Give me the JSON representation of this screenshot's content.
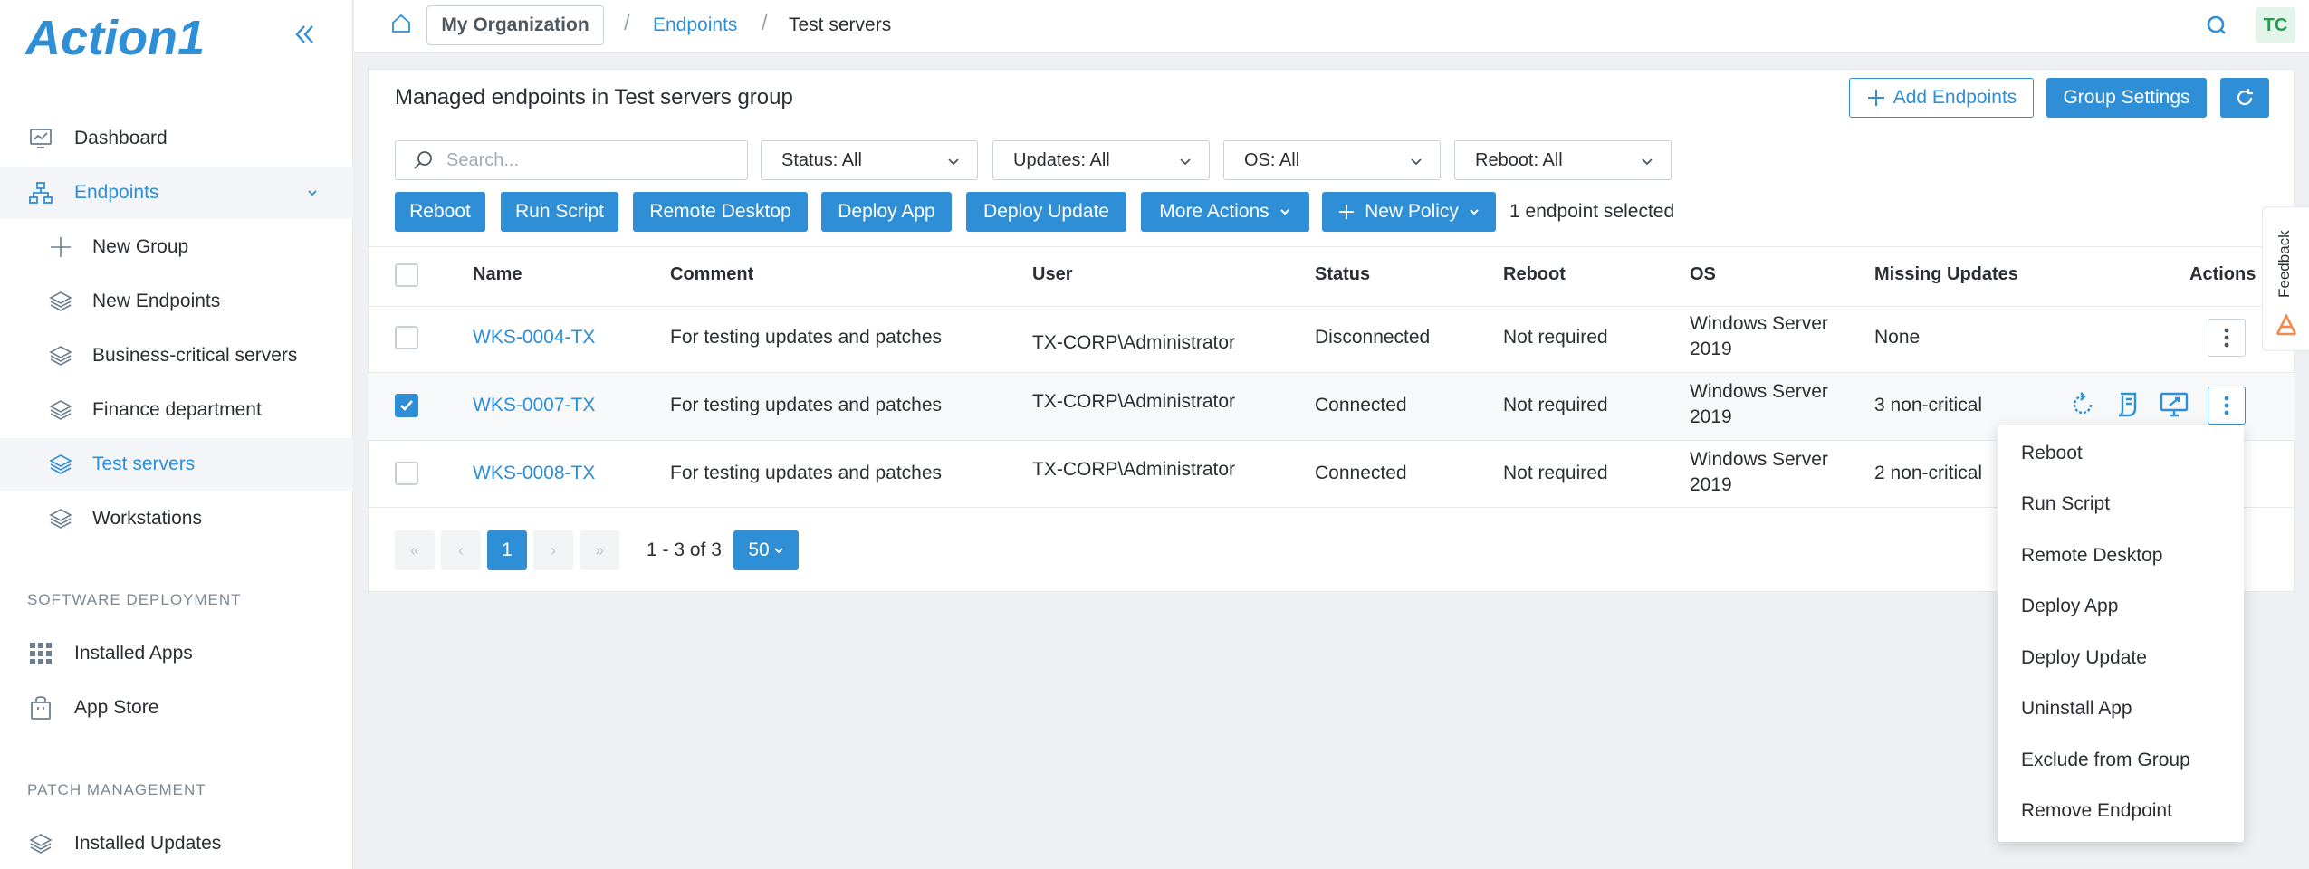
{
  "brand": {
    "logo_text": "Action1",
    "accent": "#2f8fd6"
  },
  "sidebar": {
    "items": [
      {
        "label": "Dashboard",
        "icon": "dashboard-icon"
      },
      {
        "label": "Endpoints",
        "icon": "network-icon",
        "expanded": true
      },
      {
        "label": "New Group",
        "icon": "plus-icon"
      },
      {
        "label": "New Endpoints",
        "icon": "layers-icon"
      },
      {
        "label": "Business-critical servers",
        "icon": "layers-icon"
      },
      {
        "label": "Finance department",
        "icon": "layers-icon"
      },
      {
        "label": "Test servers",
        "icon": "layers-icon",
        "active": true
      },
      {
        "label": "Workstations",
        "icon": "layers-icon"
      }
    ],
    "sections": [
      {
        "title": "SOFTWARE DEPLOYMENT",
        "items": [
          {
            "label": "Installed Apps",
            "icon": "grid-icon"
          },
          {
            "label": "App Store",
            "icon": "store-icon"
          }
        ]
      },
      {
        "title": "PATCH MANAGEMENT",
        "items": [
          {
            "label": "Installed Updates",
            "icon": "layers-icon"
          }
        ]
      }
    ]
  },
  "topbar": {
    "org": "My Organization",
    "breadcrumb_link": "Endpoints",
    "breadcrumb_current": "Test servers",
    "avatar": "TC"
  },
  "panel": {
    "title": "Managed endpoints in Test servers group",
    "add_endpoints": "Add Endpoints",
    "group_settings": "Group Settings"
  },
  "filters": {
    "search_placeholder": "Search...",
    "status": "Status: All",
    "updates": "Updates: All",
    "os": "OS: All",
    "reboot": "Reboot: All"
  },
  "actions": {
    "reboot": "Reboot",
    "run_script": "Run Script",
    "remote_desktop": "Remote Desktop",
    "deploy_app": "Deploy App",
    "deploy_update": "Deploy Update",
    "more_actions": "More Actions",
    "new_policy": "New Policy",
    "selected_count": "1 endpoint selected"
  },
  "table": {
    "columns": [
      "Name",
      "Comment",
      "User",
      "Status",
      "Reboot",
      "OS",
      "Missing Updates",
      "Actions"
    ],
    "rows": [
      {
        "name": "WKS-0004-TX",
        "comment": "For testing updates and patches",
        "user": "TX-CORP\\Administrator",
        "status": "Disconnected",
        "reboot": "Not required",
        "os_line1": "Windows Server",
        "os_line2": "2019",
        "missing": "None",
        "selected": false
      },
      {
        "name": "WKS-0007-TX",
        "comment": "For testing updates and patches",
        "user": "TX-CORP\\Administrator",
        "status": "Connected",
        "reboot": "Not required",
        "os_line1": "Windows Server",
        "os_line2": "2019",
        "missing": "3 non-critical",
        "selected": true
      },
      {
        "name": "WKS-0008-TX",
        "comment": "For testing updates and patches",
        "user": "TX-CORP\\Administrator",
        "status": "Connected",
        "reboot": "Not required",
        "os_line1": "Windows Server",
        "os_line2": "2019",
        "missing": "2 non-critical",
        "selected": false
      }
    ]
  },
  "pagination": {
    "current": "1",
    "info": "1 - 3 of 3",
    "page_size": "50"
  },
  "menu": {
    "items": [
      "Reboot",
      "Run Script",
      "Remote Desktop",
      "Deploy App",
      "Deploy Update",
      "Uninstall App",
      "Exclude from Group",
      "Remove Endpoint"
    ]
  },
  "feedback": {
    "label": "Feedback"
  }
}
